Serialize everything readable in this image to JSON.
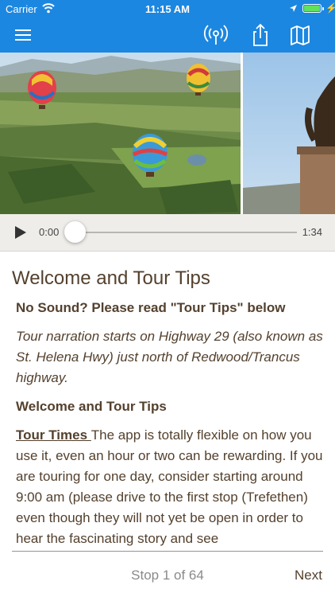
{
  "status_bar": {
    "carrier": "Carrier",
    "time": "11:15 AM",
    "icons": [
      "wifi-icon",
      "location-arrow-icon",
      "battery-icon",
      "charging-bolt-icon"
    ]
  },
  "navbar": {
    "background": "#1c87e0",
    "icons": [
      "hamburger-menu-icon",
      "broadcast-icon",
      "share-icon",
      "map-icon"
    ]
  },
  "player": {
    "time_current": "0:00",
    "time_total": "1:34",
    "progress": 0,
    "play_icon": "play-icon"
  },
  "content": {
    "title": "Welcome and Tour Tips",
    "no_sound": "No Sound? Please read \"Tour Tips\" below",
    "narration": "Tour narration starts on Highway 29 (also known as St. Helena Hwy) just north of Redwood/Trancus highway.",
    "section_heading": "Welcome and Tour Tips",
    "tour_times_label": "Tour Times ",
    "tour_times_text": "The app is totally flexible on how you use it, even an hour or two can be rewarding. If you are touring for one day, consider starting around 9:00 am (please drive to the first stop (Trefethen) even though they will not yet be open in order to hear the fascinating story and see"
  },
  "footer": {
    "stop_label": "Stop 1 of 64",
    "next_label": "Next"
  }
}
